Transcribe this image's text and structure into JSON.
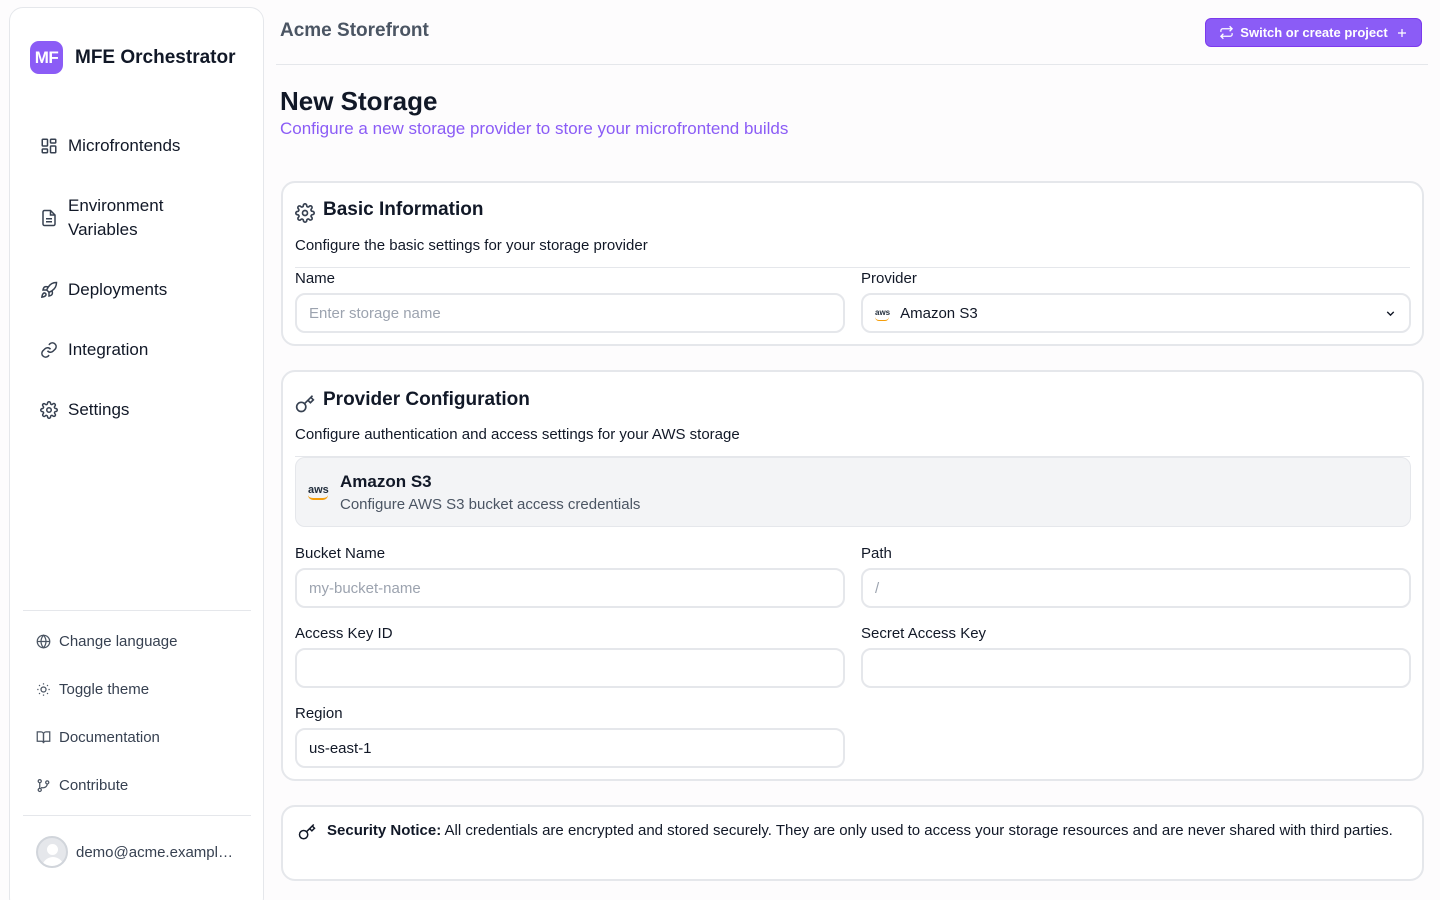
{
  "app": {
    "logo_text": "MF",
    "name": "MFE Orchestrator"
  },
  "sidebar": {
    "items": [
      {
        "label": "Microfrontends",
        "icon": "grid-icon"
      },
      {
        "label": "Environment Variables",
        "icon": "file-text-icon"
      },
      {
        "label": "Deployments",
        "icon": "rocket-icon"
      },
      {
        "label": "Integration",
        "icon": "link-icon"
      },
      {
        "label": "Settings",
        "icon": "gear-icon"
      }
    ],
    "bottom_links": [
      {
        "label": "Change language",
        "icon": "globe-icon"
      },
      {
        "label": "Toggle theme",
        "icon": "sun-icon"
      },
      {
        "label": "Documentation",
        "icon": "book-icon"
      },
      {
        "label": "Contribute",
        "icon": "git-branch-icon"
      }
    ],
    "user_email": "demo@acme.example.com"
  },
  "header": {
    "project_name": "Acme Storefront",
    "switch_label": "Switch or create project"
  },
  "page": {
    "title": "New Storage",
    "subtitle": "Configure a new storage provider to store your microfrontend builds"
  },
  "basic_info": {
    "title": "Basic Information",
    "description": "Configure the basic settings for your storage provider",
    "name_label": "Name",
    "name_placeholder": "Enter storage name",
    "provider_label": "Provider",
    "provider_value": "Amazon S3",
    "provider_logo_text": "aws"
  },
  "provider_config": {
    "title": "Provider Configuration",
    "description": "Configure authentication and access settings for your AWS storage",
    "provider_name": "Amazon S3",
    "provider_description": "Configure AWS S3 bucket access credentials",
    "provider_logo_text": "aws",
    "bucket_label": "Bucket Name",
    "bucket_placeholder": "my-bucket-name",
    "path_label": "Path",
    "path_placeholder": "/",
    "access_key_label": "Access Key ID",
    "access_key_value": "",
    "secret_key_label": "Secret Access Key",
    "secret_key_value": "",
    "region_label": "Region",
    "region_value": "us-east-1"
  },
  "security_notice": {
    "title": "Security Notice:",
    "text": "All credentials are encrypted and stored securely. They are only used to access your storage resources and are never shared with third parties."
  },
  "colors": {
    "accent": "#8b5cf6",
    "border": "#e5e7eb"
  }
}
